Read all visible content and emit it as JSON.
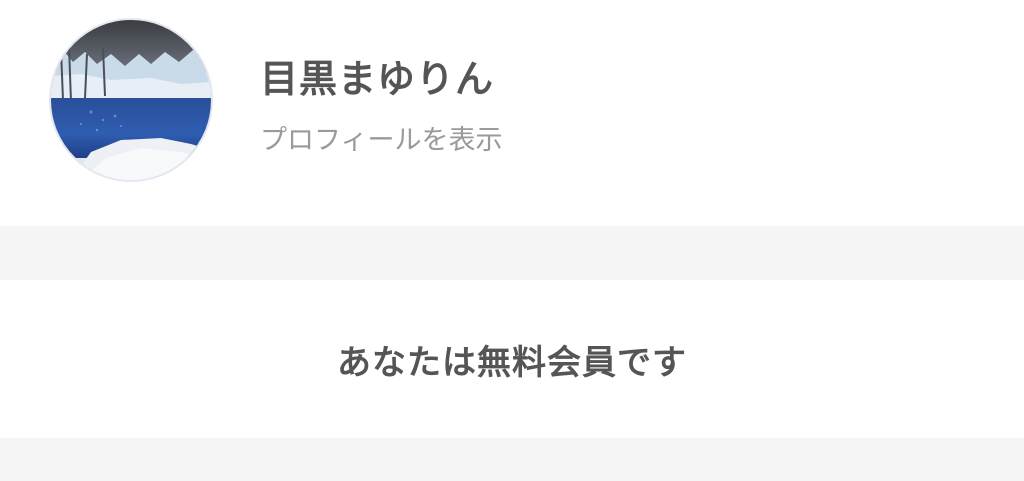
{
  "profile": {
    "name": "目黒まゆりん",
    "view_profile_label": "プロフィールを表示",
    "avatar_description": "avatar-photo"
  },
  "membership": {
    "status_text": "あなたは無料会員です"
  },
  "colors": {
    "text_primary": "#555555",
    "text_secondary": "#9a9a9a",
    "separator": "#f5f5f5",
    "background": "#ffffff"
  }
}
